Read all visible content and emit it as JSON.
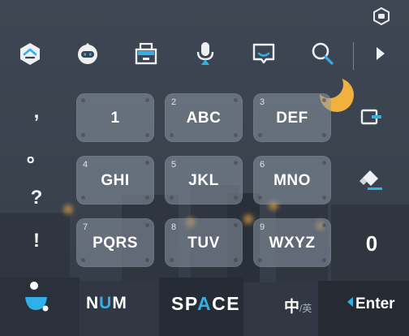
{
  "colors": {
    "accent": "#2fb0ea",
    "key_bg": "#8b95a3",
    "background": "#3b4350",
    "moon": "#f2b13f"
  },
  "top_corner": {
    "icon": "keyboard-settings-icon"
  },
  "toolbar": {
    "items": [
      {
        "icon": "home-hexagon-icon"
      },
      {
        "icon": "robot-face-icon"
      },
      {
        "icon": "clipboard-tray-icon"
      },
      {
        "icon": "microphone-icon"
      },
      {
        "icon": "speech-bubble-icon"
      },
      {
        "icon": "search-icon"
      },
      {
        "icon": "play-arrow-icon"
      }
    ],
    "night_mode_icon": "moon-icon"
  },
  "punctuation": [
    ",",
    "。",
    "?",
    "!"
  ],
  "keys": [
    {
      "num": "",
      "label": "1"
    },
    {
      "num": "2",
      "label": "ABC"
    },
    {
      "num": "3",
      "label": "DEF"
    },
    {
      "num": "4",
      "label": "GHI"
    },
    {
      "num": "5",
      "label": "JKL"
    },
    {
      "num": "6",
      "label": "MNO"
    },
    {
      "num": "7",
      "label": "PQRS"
    },
    {
      "num": "8",
      "label": "TUV"
    },
    {
      "num": "9",
      "label": "WXYZ"
    }
  ],
  "side_keys": {
    "delete_icon": "backspace-icon",
    "clear_icon": "eraser-icon",
    "zero_label": "0"
  },
  "bottom": {
    "logo_icon": "input-method-logo-icon",
    "num_prefix": "N",
    "num_accent": "U",
    "num_suffix": "M",
    "space_prefix": "SP",
    "space_accent": "A",
    "space_suffix": "CE",
    "lang_main": "中",
    "lang_sub": "/英",
    "enter_label": "Enter"
  }
}
